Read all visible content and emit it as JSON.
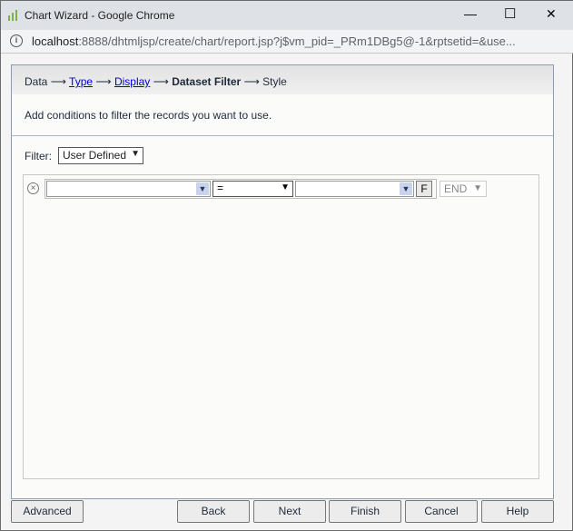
{
  "window": {
    "title": "Chart Wizard - Google Chrome",
    "min": "—",
    "max": "☐",
    "close": "✕"
  },
  "address": {
    "host": "localhost",
    "rest": ":8888/dhtmljsp/create/chart/report.jsp?j$vm_pid=_PRm1DBg5@-1&rptsetid=&use..."
  },
  "steps": {
    "data": "Data",
    "type": "Type",
    "display": "Display",
    "current": "Dataset Filter",
    "style": "Style",
    "arrow": "⟶"
  },
  "description": "Add conditions to filter the records you want to use.",
  "filter": {
    "label": "Filter:",
    "value": "User Defined"
  },
  "condition": {
    "field": "",
    "operator": "=",
    "value": "",
    "f_button": "F",
    "logic": "END"
  },
  "buttons": {
    "advanced": "Advanced",
    "back": "Back",
    "next": "Next",
    "finish": "Finish",
    "cancel": "Cancel",
    "help": "Help"
  }
}
